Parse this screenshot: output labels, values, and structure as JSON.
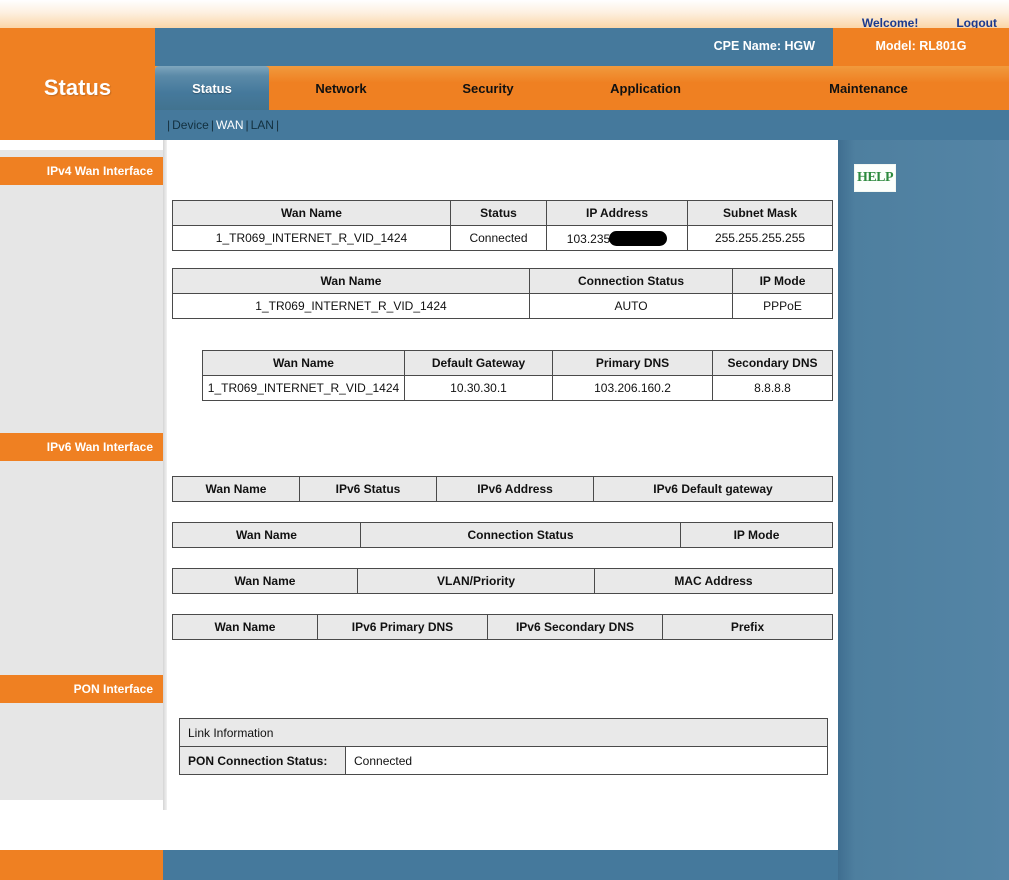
{
  "header": {
    "welcome_label": "Welcome!",
    "logout_label": "Logout",
    "cpe_name": "CPE Name: HGW",
    "model": "Model: RL801G",
    "page_title": "Status"
  },
  "nav": {
    "tabs": [
      {
        "label": "Status",
        "active": true
      },
      {
        "label": "Network",
        "active": false
      },
      {
        "label": "Security",
        "active": false
      },
      {
        "label": "Application",
        "active": false
      },
      {
        "label": "Maintenance",
        "active": false
      }
    ]
  },
  "subnav": {
    "prefix": "|",
    "items": [
      {
        "label": "Device",
        "active": false
      },
      {
        "label": "WAN",
        "active": true
      },
      {
        "label": "LAN",
        "active": false
      }
    ],
    "separator": "|"
  },
  "sidebar": {
    "sections": [
      {
        "label": "IPv4 Wan Interface"
      },
      {
        "label": "IPv6 Wan Interface"
      },
      {
        "label": "PON Interface"
      }
    ]
  },
  "help": {
    "label": "HELP"
  },
  "ipv4": {
    "table1": {
      "headers": [
        "Wan Name",
        "Status",
        "IP Address",
        "Subnet Mask"
      ],
      "rows": [
        {
          "wan_name": "1_TR069_INTERNET_R_VID_1424",
          "status": "Connected",
          "ip_address": "103.235",
          "ip_address_redacted": true,
          "subnet_mask": "255.255.255.255"
        }
      ]
    },
    "table2": {
      "headers": [
        "Wan Name",
        "Connection Status",
        "IP Mode"
      ],
      "rows": [
        {
          "wan_name": "1_TR069_INTERNET_R_VID_1424",
          "connection_status": "AUTO",
          "ip_mode": "PPPoE"
        }
      ]
    },
    "table3": {
      "headers": [
        "Wan Name",
        "Default Gateway",
        "Primary DNS",
        "Secondary DNS"
      ],
      "rows": [
        {
          "wan_name": "1_TR069_INTERNET_R_VID_1424",
          "default_gateway": "10.30.30.1",
          "primary_dns": "103.206.160.2",
          "secondary_dns": "8.8.8.8"
        }
      ]
    }
  },
  "ipv6": {
    "table1": {
      "headers": [
        "Wan Name",
        "IPv6 Status",
        "IPv6 Address",
        "IPv6 Default gateway"
      ],
      "rows": []
    },
    "table2": {
      "headers": [
        "Wan Name",
        "Connection Status",
        "IP Mode"
      ],
      "rows": []
    },
    "table3": {
      "headers": [
        "Wan Name",
        "VLAN/Priority",
        "MAC Address"
      ],
      "rows": []
    },
    "table4": {
      "headers": [
        "Wan Name",
        "IPv6 Primary DNS",
        "IPv6 Secondary DNS",
        "Prefix"
      ],
      "rows": []
    }
  },
  "pon": {
    "link_information_label": "Link Information",
    "status_label": "PON Connection Status:",
    "status_value": "Connected"
  },
  "colors": {
    "orange": "#ef8022",
    "steel_blue": "#45799c",
    "rail_blue": "#4e7f9f",
    "sidebar_gray": "#e6e6e6",
    "header_link": "#1b3a8f",
    "help_green": "#2d8a3e",
    "table_header": "#e9e9e9"
  }
}
